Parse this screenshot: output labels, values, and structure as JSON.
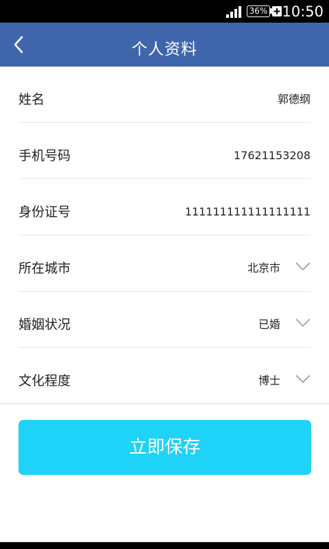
{
  "status_bar": {
    "battery": "36%",
    "time": "10:50"
  },
  "header": {
    "title": "个人资料",
    "back_icon": "chevron-left-icon"
  },
  "form": {
    "rows": [
      {
        "label": "姓名",
        "value": "郭德纲",
        "dropdown": false
      },
      {
        "label": "手机号码",
        "value": "17621153208",
        "dropdown": false
      },
      {
        "label": "身份证号",
        "value": "111111111111111111",
        "dropdown": false
      },
      {
        "label": "所在城市",
        "value": "北京市",
        "dropdown": true
      },
      {
        "label": "婚姻状况",
        "value": "已婚",
        "dropdown": true
      },
      {
        "label": "文化程度",
        "value": "博士",
        "dropdown": true
      }
    ]
  },
  "save_button": {
    "label": "立即保存"
  },
  "colors": {
    "header": "#3f66ad",
    "button": "#1fd2f7",
    "divider": "#e5e5e5",
    "text": "#222222"
  }
}
